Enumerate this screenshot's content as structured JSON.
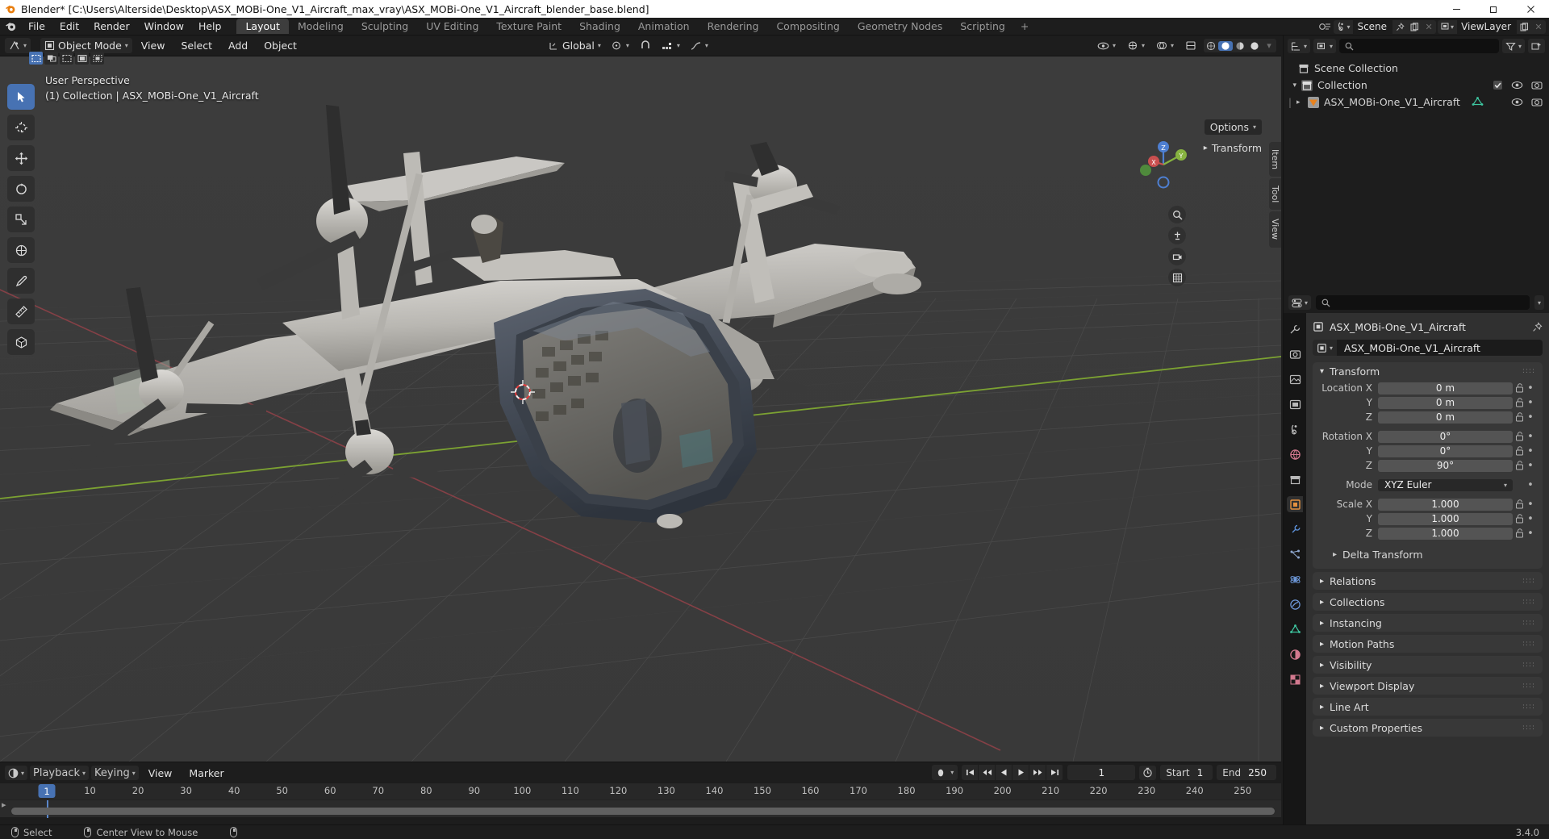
{
  "window": {
    "title": "Blender* [C:\\Users\\Alterside\\Desktop\\ASX_MOBi-One_V1_Aircraft_max_vray\\ASX_MOBi-One_V1_Aircraft_blender_base.blend]",
    "minimize": "minimize-icon",
    "maximize": "restore-icon",
    "close": "close-icon"
  },
  "menubar": {
    "items": [
      "File",
      "Edit",
      "Render",
      "Window",
      "Help"
    ],
    "workspaces": [
      {
        "label": "Layout",
        "active": true
      },
      {
        "label": "Modeling",
        "active": false
      },
      {
        "label": "Sculpting",
        "active": false
      },
      {
        "label": "UV Editing",
        "active": false
      },
      {
        "label": "Texture Paint",
        "active": false
      },
      {
        "label": "Shading",
        "active": false
      },
      {
        "label": "Animation",
        "active": false
      },
      {
        "label": "Rendering",
        "active": false
      },
      {
        "label": "Compositing",
        "active": false
      },
      {
        "label": "Geometry Nodes",
        "active": false
      },
      {
        "label": "Scripting",
        "active": false
      }
    ],
    "add_workspace": "+",
    "scene": {
      "label": "Scene",
      "icon": "scene-icon",
      "pin": "pin-icon",
      "new": "new-icon",
      "unlink": "x-icon"
    },
    "viewlayer": {
      "label": "ViewLayer",
      "icon": "viewlayer-icon",
      "new": "new-icon",
      "unlink": "x-icon"
    }
  },
  "view3d_header": {
    "editor_type": "editor-type-icon",
    "mode": "Object Mode",
    "menus": [
      "View",
      "Select",
      "Add",
      "Object"
    ],
    "orientation": "Global",
    "options_label": "Options",
    "select_modes": [
      "tweak",
      "box-select",
      "circle-select",
      "lasso-select",
      "extend-select"
    ]
  },
  "viewport": {
    "perspective_label": "User Perspective",
    "collection_label": "(1) Collection | ASX_MOBi-One_V1_Aircraft",
    "transform_tab": "Transform",
    "side_tabs": [
      "Item",
      "Tool",
      "View"
    ],
    "gizmo_axes": [
      "Z",
      "Y",
      "X"
    ],
    "nav_buttons": [
      "zoom-icon",
      "pan-icon",
      "camera-icon",
      "grid-ortho-icon"
    ],
    "tools": [
      "select-box-tool",
      "cursor-tool",
      "move-tool",
      "rotate-tool",
      "scale-tool",
      "transform-tool",
      "annotate-tool",
      "measure-tool",
      "add-cube-tool"
    ]
  },
  "outliner": {
    "display_mode": "outliner-display-icon",
    "filter_id": "view-layer-icon",
    "search_placeholder": "",
    "filter_icon": "funnel-icon",
    "new_collection_icon": "new-collection-icon",
    "rows": [
      {
        "label": "Scene Collection",
        "depth": 0,
        "icon": "collection-icon",
        "expandable": false,
        "checkbox": false,
        "eye": false,
        "camera": false
      },
      {
        "label": "Collection",
        "depth": 1,
        "icon": "collection-icon",
        "expandable": true,
        "checkbox": true,
        "eye": true,
        "camera": true
      },
      {
        "label": "ASX_MOBi-One_V1_Aircraft",
        "depth": 2,
        "icon": "mesh-object-icon",
        "expandable": true,
        "checkbox": false,
        "eye": true,
        "camera": true,
        "data_icon": "mesh-data-icon"
      }
    ]
  },
  "properties": {
    "editor_icon": "properties-editor-icon",
    "search_placeholder": "",
    "breadcrumb_object": "ASX_MOBi-One_V1_Aircraft",
    "pin_icon": "pin-icon",
    "id_name": "ASX_MOBi-One_V1_Aircraft",
    "tabs": [
      "tool-tab",
      "render-tab",
      "output-tab",
      "view-layer-tab",
      "scene-tab",
      "world-tab",
      "collection-tab",
      "object-tab",
      "modifiers-tab",
      "particles-tab",
      "physics-tab",
      "constraints-tab",
      "data-tab",
      "material-tab",
      "texture-tab"
    ],
    "active_tab_index": 7,
    "transform": {
      "title": "Transform",
      "fields": [
        {
          "label": "Location X",
          "value": "0 m"
        },
        {
          "label": "Y",
          "value": "0 m"
        },
        {
          "label": "Z",
          "value": "0 m"
        },
        {
          "label": "Rotation X",
          "value": "0°"
        },
        {
          "label": "Y",
          "value": "0°"
        },
        {
          "label": "Z",
          "value": "90°"
        }
      ],
      "mode_label": "Mode",
      "mode_value": "XYZ Euler",
      "scale_fields": [
        {
          "label": "Scale X",
          "value": "1.000"
        },
        {
          "label": "Y",
          "value": "1.000"
        },
        {
          "label": "Z",
          "value": "1.000"
        }
      ],
      "delta_transform": "Delta Transform"
    },
    "panels": [
      "Relations",
      "Collections",
      "Instancing",
      "Motion Paths",
      "Visibility",
      "Viewport Display",
      "Line Art",
      "Custom Properties"
    ]
  },
  "timeline": {
    "editor_icon": "timeline-editor-icon",
    "menus": [
      "Playback",
      "Keying",
      "View",
      "Marker"
    ],
    "keyset_icon": "keying-set-icon",
    "transport": [
      "jump-start-icon",
      "prev-keyframe-icon",
      "play-reverse-icon",
      "play-icon",
      "next-keyframe-icon",
      "jump-end-icon"
    ],
    "current_frame": "1",
    "start_label": "Start",
    "start_value": "1",
    "end_label": "End",
    "end_value": "250",
    "ticks": [
      1,
      10,
      20,
      30,
      40,
      50,
      60,
      70,
      80,
      90,
      100,
      110,
      120,
      130,
      140,
      150,
      160,
      170,
      180,
      190,
      200,
      210,
      220,
      230,
      240,
      250
    ],
    "playhead_frame": "1"
  },
  "statusbar": {
    "items": [
      {
        "icon": "mouse-left-icon",
        "label": "Select"
      },
      {
        "icon": "mouse-middle-icon",
        "label": "Center View to Mouse"
      },
      {
        "icon": "mouse-right-icon",
        "label": ""
      }
    ],
    "version": "3.4.0"
  },
  "colors": {
    "accent": "#4772b3",
    "axis_x": "#a6444a",
    "axis_y": "#7fa832",
    "panel": "#383838",
    "editor_bg": "#1d1d1d",
    "viewport_bg": "#3b3b3b"
  }
}
